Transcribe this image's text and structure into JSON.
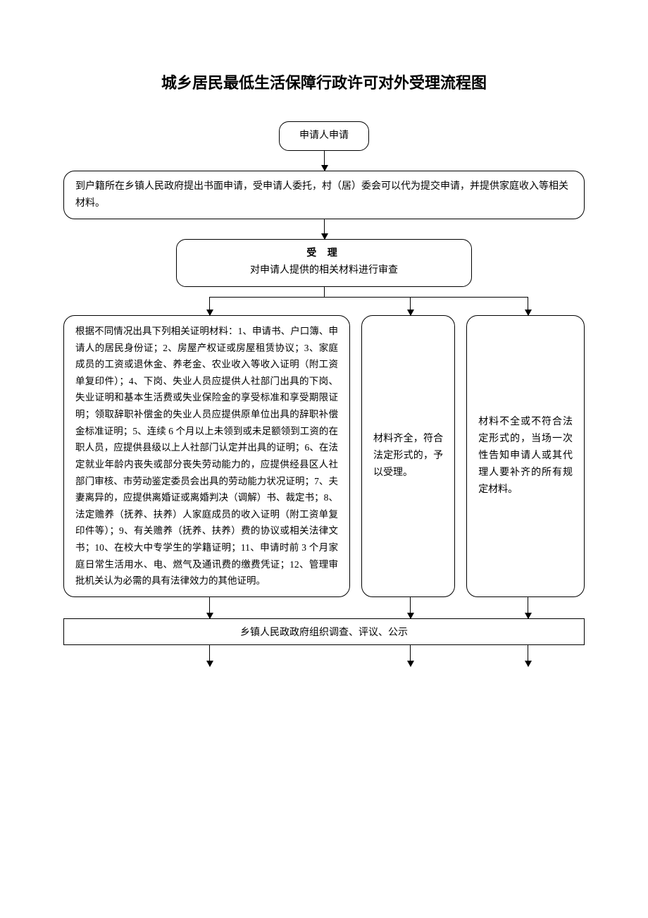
{
  "title": "城乡居民最低生活保障行政许可对外受理流程图",
  "step1": "申请人申请",
  "step2": "到户籍所在乡镇人民政府提出书面申请，受申请人委托，村（居）委会可以代为提交申请，并提供家庭收入等相关材料。",
  "step3_title": "受 理",
  "step3_sub": "对申请人提供的相关材料进行审查",
  "branch_a": "根据不同情况出具下列相关证明材料：1、申请书、户口簿、申请人的居民身份证；2、房屋产权证或房屋租赁协议；3、家庭成员的工资或退休金、养老金、农业收入等收入证明（附工资单复印件）；4、下岗、失业人员应提供人社部门出具的下岗、失业证明和基本生活费或失业保险金的享受标准和享受期限证明；领取辞职补偿金的失业人员应提供原单位出具的辞职补偿金标准证明；5、连续 6 个月以上未领到或未足额领到工资的在职人员，应提供县级以上人社部门认定并出具的证明；6、在法定就业年龄内丧失或部分丧失劳动能力的，应提供经县区人社部门审核、市劳动鉴定委员会出具的劳动能力状况证明；7、夫妻离异的，应提供离婚证或离婚判决（调解）书、裁定书；8、法定赡养（抚养、扶养）人家庭成员的收入证明（附工资单复印件等）；9、有关赡养（抚养、扶养）费的协议或相关法律文书；10、在校大中专学生的学籍证明；11、申请时前 3 个月家庭日常生活用水、电、燃气及通讯费的缴费凭证；12、管理审批机关认为必需的具有法律效力的其他证明。",
  "branch_b": "材料齐全，符合法定形式的，予以受理。",
  "branch_c": "材料不全或不符合法定形式的，当场一次性告知申请人或其代理人要补齐的所有规定材料。",
  "step5": "乡镇人民政政府组织调查、评议、公示"
}
